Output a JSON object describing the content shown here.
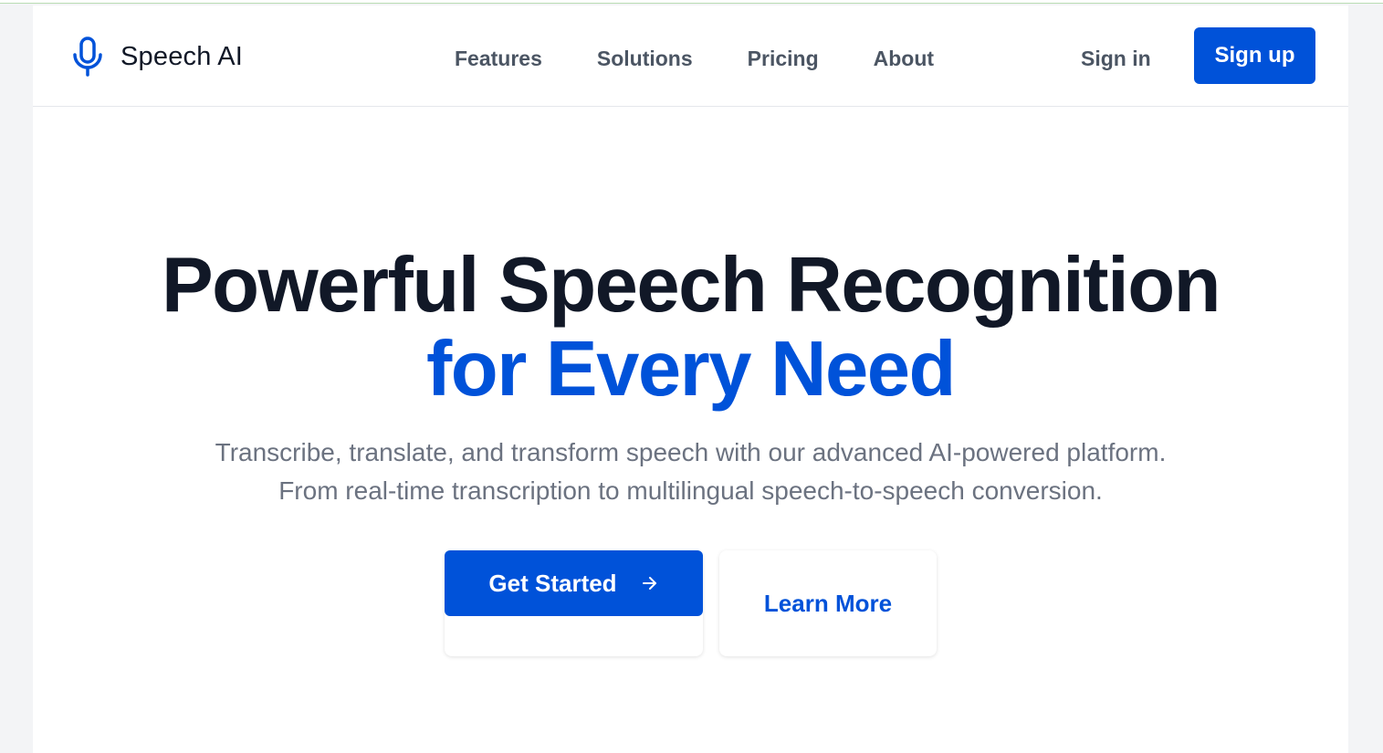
{
  "brand": {
    "name": "Speech AI",
    "icon": "microphone-icon"
  },
  "nav": {
    "links": [
      {
        "label": "Features"
      },
      {
        "label": "Solutions"
      },
      {
        "label": "Pricing"
      },
      {
        "label": "About"
      }
    ],
    "sign_in": "Sign in",
    "sign_up": "Sign up"
  },
  "hero": {
    "headline_line1": "Powerful Speech Recognition",
    "headline_line2": "for Every Need",
    "subtitle_line1": "Transcribe, translate, and transform speech with our advanced AI-powered platform.",
    "subtitle_line2": "From real-time transcription to multilingual speech-to-speech conversion.",
    "primary_cta": "Get Started",
    "primary_cta_icon": "arrow-right-icon",
    "secondary_cta": "Learn More"
  },
  "colors": {
    "accent": "#0052d9",
    "heading": "#111827",
    "muted": "#6b7280",
    "nav_text": "#4b5563"
  }
}
